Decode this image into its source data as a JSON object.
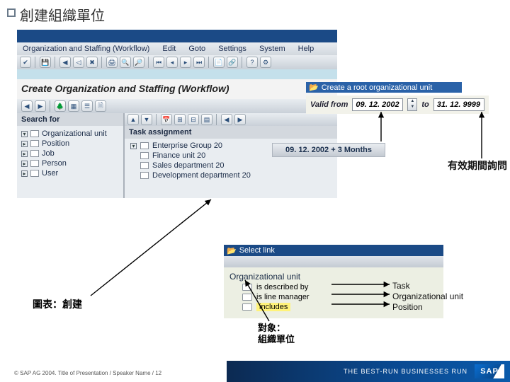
{
  "slide": {
    "title": "創建組織單位"
  },
  "menubar": {
    "m1": "Organization and Staffing (Workflow)",
    "m2": "Edit",
    "m3": "Goto",
    "m4": "Settings",
    "m5": "System",
    "m6": "Help"
  },
  "subheader": "Create Organization and Staffing (Workflow)",
  "create_root_banner": "Create a root organizational unit",
  "valid": {
    "label": "Valid from",
    "from": "09. 12. 2002",
    "to_lbl": "to",
    "to": "31. 12. 9999"
  },
  "range_band": "09. 12. 2002 + 3 Months",
  "search": {
    "heading": "Search for",
    "items": [
      "Organizational unit",
      "Position",
      "Job",
      "Person",
      "User"
    ]
  },
  "task": {
    "heading": "Task assignment",
    "items": [
      "Enterprise Group 20",
      "Finance unit 20",
      "Sales department 20",
      "Development department 20"
    ]
  },
  "select_link": {
    "title": "Select link",
    "section": "Organizational unit",
    "rows": [
      "is described by",
      "is line manager",
      "includes"
    ]
  },
  "right_labels": [
    "Task",
    "Organizational unit",
    "Position"
  ],
  "callouts": {
    "validity": "有效期間詢問",
    "figure": "圖表：創建",
    "object_l1": "對象：",
    "object_l2": "組織單位"
  },
  "footer": {
    "tag": "THE BEST-RUN BUSINESSES RUN",
    "brand": "SAP",
    "copyright": "© SAP AG 2004. Title of Presentation / Speaker Name / 12"
  }
}
